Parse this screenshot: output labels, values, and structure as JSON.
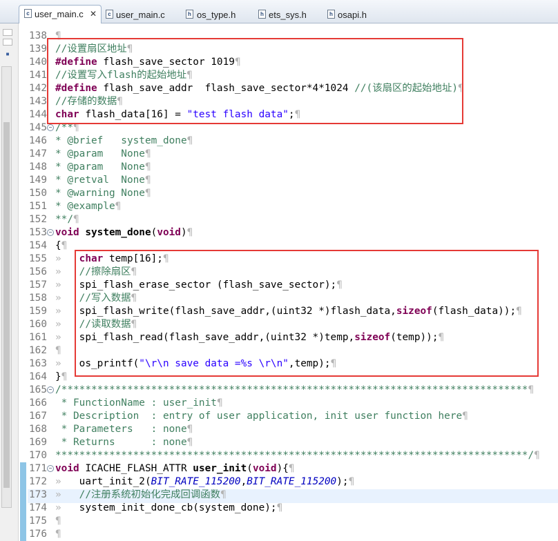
{
  "tabs": [
    {
      "label": "user_main.c",
      "active": true,
      "icon": "c-file-icon"
    },
    {
      "label": "user_main.c",
      "active": false,
      "icon": "c-file-icon"
    },
    {
      "label": "os_type.h",
      "active": false,
      "icon": "h-file-icon"
    },
    {
      "label": "ets_sys.h",
      "active": false,
      "icon": "h-file-icon"
    },
    {
      "label": "osapi.h",
      "active": false,
      "icon": "h-file-icon"
    }
  ],
  "tab_close_glyph": "✕",
  "colors": {
    "comment": "#3f7f5f",
    "keyword": "#7f0055",
    "string": "#2a00ff",
    "highlight_box": "#e53935",
    "current_line": "#e8f2fe"
  },
  "lines": [
    {
      "n": "138",
      "fold": false,
      "parts": [
        {
          "t": "¶",
          "c": "ws"
        }
      ]
    },
    {
      "n": "139",
      "fold": false,
      "parts": [
        {
          "t": "//设置扇区地址",
          "c": "cmt"
        },
        {
          "t": "¶",
          "c": "ws"
        }
      ]
    },
    {
      "n": "140",
      "fold": false,
      "parts": [
        {
          "t": "#define",
          "c": "kw"
        },
        {
          "t": " flash_save_sector 1019",
          "c": ""
        },
        {
          "t": "¶",
          "c": "ws"
        }
      ]
    },
    {
      "n": "141",
      "fold": false,
      "parts": [
        {
          "t": "//设置写入flash的起始地址",
          "c": "cmt"
        },
        {
          "t": "¶",
          "c": "ws"
        }
      ]
    },
    {
      "n": "142",
      "fold": false,
      "parts": [
        {
          "t": "#define",
          "c": "kw"
        },
        {
          "t": " flash_save_addr  flash_save_sector*4*1024 ",
          "c": ""
        },
        {
          "t": "//(该扇区的起始地址)",
          "c": "cmt"
        },
        {
          "t": "¶",
          "c": "ws"
        }
      ]
    },
    {
      "n": "143",
      "fold": false,
      "parts": [
        {
          "t": "//存储的数据",
          "c": "cmt"
        },
        {
          "t": "¶",
          "c": "ws"
        }
      ]
    },
    {
      "n": "144",
      "fold": false,
      "parts": [
        {
          "t": "char",
          "c": "kw"
        },
        {
          "t": " flash_data[16] = ",
          "c": ""
        },
        {
          "t": "\"test flash data\"",
          "c": "str"
        },
        {
          "t": ";",
          "c": ""
        },
        {
          "t": "¶",
          "c": "ws"
        }
      ]
    },
    {
      "n": "145",
      "fold": true,
      "parts": [
        {
          "t": "/**",
          "c": "cmt"
        },
        {
          "t": "¶",
          "c": "ws"
        }
      ]
    },
    {
      "n": "146",
      "fold": false,
      "parts": [
        {
          "t": "* @brief   system_done",
          "c": "cmt"
        },
        {
          "t": "¶",
          "c": "ws"
        }
      ]
    },
    {
      "n": "147",
      "fold": false,
      "parts": [
        {
          "t": "* @param   None",
          "c": "cmt"
        },
        {
          "t": "¶",
          "c": "ws"
        }
      ]
    },
    {
      "n": "148",
      "fold": false,
      "parts": [
        {
          "t": "* @param   None",
          "c": "cmt"
        },
        {
          "t": "¶",
          "c": "ws"
        }
      ]
    },
    {
      "n": "149",
      "fold": false,
      "parts": [
        {
          "t": "* @retval  None",
          "c": "cmt"
        },
        {
          "t": "¶",
          "c": "ws"
        }
      ]
    },
    {
      "n": "150",
      "fold": false,
      "parts": [
        {
          "t": "* @warning None",
          "c": "cmt"
        },
        {
          "t": "¶",
          "c": "ws"
        }
      ]
    },
    {
      "n": "151",
      "fold": false,
      "parts": [
        {
          "t": "* @example",
          "c": "cmt"
        },
        {
          "t": "¶",
          "c": "ws"
        }
      ]
    },
    {
      "n": "152",
      "fold": false,
      "parts": [
        {
          "t": "**/",
          "c": "cmt"
        },
        {
          "t": "¶",
          "c": "ws"
        }
      ]
    },
    {
      "n": "153",
      "fold": true,
      "parts": [
        {
          "t": "void",
          "c": "kw"
        },
        {
          "t": " ",
          "c": ""
        },
        {
          "t": "system_done",
          "c": "fn"
        },
        {
          "t": "(",
          "c": ""
        },
        {
          "t": "void",
          "c": "kw"
        },
        {
          "t": ")",
          "c": ""
        },
        {
          "t": "¶",
          "c": "ws"
        }
      ]
    },
    {
      "n": "154",
      "fold": false,
      "parts": [
        {
          "t": "{",
          "c": ""
        },
        {
          "t": "¶",
          "c": "ws"
        }
      ]
    },
    {
      "n": "155",
      "fold": false,
      "parts": [
        {
          "t": "»   ",
          "c": "ws"
        },
        {
          "t": "char",
          "c": "kw"
        },
        {
          "t": " temp[16];",
          "c": ""
        },
        {
          "t": "¶",
          "c": "ws"
        }
      ]
    },
    {
      "n": "156",
      "fold": false,
      "parts": [
        {
          "t": "»   ",
          "c": "ws"
        },
        {
          "t": "//擦除扇区",
          "c": "cmt"
        },
        {
          "t": "¶",
          "c": "ws"
        }
      ]
    },
    {
      "n": "157",
      "fold": false,
      "parts": [
        {
          "t": "»   ",
          "c": "ws"
        },
        {
          "t": "spi_flash_erase_sector (flash_save_sector);",
          "c": ""
        },
        {
          "t": "¶",
          "c": "ws"
        }
      ]
    },
    {
      "n": "158",
      "fold": false,
      "parts": [
        {
          "t": "»   ",
          "c": "ws"
        },
        {
          "t": "//写入数据",
          "c": "cmt"
        },
        {
          "t": "¶",
          "c": "ws"
        }
      ]
    },
    {
      "n": "159",
      "fold": false,
      "parts": [
        {
          "t": "»   ",
          "c": "ws"
        },
        {
          "t": "spi_flash_write(flash_save_addr,(uint32 *)flash_data,",
          "c": ""
        },
        {
          "t": "sizeof",
          "c": "kw"
        },
        {
          "t": "(flash_data));",
          "c": ""
        },
        {
          "t": "¶",
          "c": "ws"
        }
      ]
    },
    {
      "n": "160",
      "fold": false,
      "parts": [
        {
          "t": "»   ",
          "c": "ws"
        },
        {
          "t": "//读取数据",
          "c": "cmt"
        },
        {
          "t": "¶",
          "c": "ws"
        }
      ]
    },
    {
      "n": "161",
      "fold": false,
      "parts": [
        {
          "t": "»   ",
          "c": "ws"
        },
        {
          "t": "spi_flash_read(flash_save_addr,(uint32 *)temp,",
          "c": ""
        },
        {
          "t": "sizeof",
          "c": "kw"
        },
        {
          "t": "(temp));",
          "c": ""
        },
        {
          "t": "¶",
          "c": "ws"
        }
      ]
    },
    {
      "n": "162",
      "fold": false,
      "parts": [
        {
          "t": "¶",
          "c": "ws"
        }
      ]
    },
    {
      "n": "163",
      "fold": false,
      "parts": [
        {
          "t": "»   ",
          "c": "ws"
        },
        {
          "t": "os_printf(",
          "c": ""
        },
        {
          "t": "\"\\r\\n save data =%s \\r\\n\"",
          "c": "str"
        },
        {
          "t": ",temp);",
          "c": ""
        },
        {
          "t": "¶",
          "c": "ws"
        }
      ]
    },
    {
      "n": "164",
      "fold": false,
      "parts": [
        {
          "t": "}",
          "c": ""
        },
        {
          "t": "¶",
          "c": "ws"
        }
      ]
    },
    {
      "n": "165",
      "fold": true,
      "parts": [
        {
          "t": "/******************************************************************************",
          "c": "cmt"
        },
        {
          "t": "¶",
          "c": "ws"
        }
      ]
    },
    {
      "n": "166",
      "fold": false,
      "parts": [
        {
          "t": " * FunctionName : user_init",
          "c": "cmt"
        },
        {
          "t": "¶",
          "c": "ws"
        }
      ]
    },
    {
      "n": "167",
      "fold": false,
      "parts": [
        {
          "t": " * Description  : entry of user application, init user function here",
          "c": "cmt"
        },
        {
          "t": "¶",
          "c": "ws"
        }
      ]
    },
    {
      "n": "168",
      "fold": false,
      "parts": [
        {
          "t": " * Parameters   : none",
          "c": "cmt"
        },
        {
          "t": "¶",
          "c": "ws"
        }
      ]
    },
    {
      "n": "169",
      "fold": false,
      "parts": [
        {
          "t": " * Returns      : none",
          "c": "cmt"
        },
        {
          "t": "¶",
          "c": "ws"
        }
      ]
    },
    {
      "n": "170",
      "fold": false,
      "parts": [
        {
          "t": "*******************************************************************************/",
          "c": "cmt"
        },
        {
          "t": "¶",
          "c": "ws"
        }
      ]
    },
    {
      "n": "171",
      "fold": true,
      "parts": [
        {
          "t": "void",
          "c": "kw"
        },
        {
          "t": " ICACHE_FLASH_ATTR ",
          "c": ""
        },
        {
          "t": "user_init",
          "c": "fn"
        },
        {
          "t": "(",
          "c": ""
        },
        {
          "t": "void",
          "c": "kw"
        },
        {
          "t": "){",
          "c": ""
        },
        {
          "t": "¶",
          "c": "ws"
        }
      ]
    },
    {
      "n": "172",
      "fold": false,
      "parts": [
        {
          "t": "»   ",
          "c": "ws"
        },
        {
          "t": "uart_init_2(",
          "c": ""
        },
        {
          "t": "BIT_RATE_115200",
          "c": "ital"
        },
        {
          "t": ",",
          "c": ""
        },
        {
          "t": "BIT_RATE_115200",
          "c": "ital"
        },
        {
          "t": ");",
          "c": ""
        },
        {
          "t": "¶",
          "c": "ws"
        }
      ]
    },
    {
      "n": "173",
      "fold": false,
      "parts": [
        {
          "t": "»   ",
          "c": "ws"
        },
        {
          "t": "//注册系统初始化完成回调函数",
          "c": "cmt"
        },
        {
          "t": "¶",
          "c": "ws"
        }
      ]
    },
    {
      "n": "174",
      "fold": false,
      "parts": [
        {
          "t": "»   ",
          "c": "ws"
        },
        {
          "t": "system_init_done_cb(system_done);",
          "c": ""
        },
        {
          "t": "¶",
          "c": "ws"
        }
      ]
    },
    {
      "n": "175",
      "fold": false,
      "parts": [
        {
          "t": "¶",
          "c": "ws"
        }
      ]
    },
    {
      "n": "176",
      "fold": false,
      "parts": [
        {
          "t": "¶",
          "c": "ws"
        }
      ]
    }
  ]
}
